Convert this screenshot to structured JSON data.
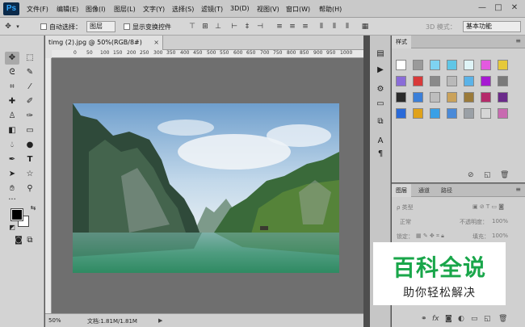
{
  "app": {
    "logo": "Ps"
  },
  "menu": {
    "items": [
      "文件(F)",
      "编辑(E)",
      "图像(I)",
      "图层(L)",
      "文字(Y)",
      "选择(S)",
      "滤镜(T)",
      "3D(D)",
      "视图(V)",
      "窗口(W)",
      "帮助(H)"
    ]
  },
  "window_controls": {
    "minimize": "—",
    "maximize": "□",
    "close": "✕"
  },
  "options_bar": {
    "auto_select_label": "自动选择：",
    "auto_select_value": "图层",
    "show_transform_label": "显示变换控件",
    "mode_3d_label": "3D 模式：",
    "workspace_value": "基本功能"
  },
  "document": {
    "tab_title": "timg (2).jpg @ 50%(RGB/8#)",
    "close": "×",
    "ruler_ticks": [
      "0",
      "50",
      "100",
      "150",
      "200",
      "250",
      "300",
      "350",
      "400",
      "450",
      "500",
      "550",
      "600",
      "650",
      "700",
      "750",
      "800",
      "850",
      "900",
      "950",
      "1000"
    ],
    "zoom": "50%",
    "doc_info": "文档:1.81M/1.81M"
  },
  "styles_panel": {
    "tab": "样式",
    "menu": "≡",
    "swatch_colors": [
      "#ffffff",
      "#9a9a9a",
      "#7ed3f2",
      "#5fc6e6",
      "#dff4f7",
      "#e35ae0",
      "#e6c93a",
      "#8a6cd8",
      "#d83a3a",
      "#8a8a8a",
      "#b9b9b9",
      "#5bb3e8",
      "#a61ad2",
      "#7a7a7a",
      "#2a2a2a",
      "#3b7fd8",
      "#bdbdbd",
      "#caa25a",
      "#9a7a3a",
      "#b42a6a",
      "#6a2a8a",
      "#2a6ad8",
      "#e0a21a",
      "#3aa0e6",
      "#4a8ad8",
      "#9aa0a6",
      "#d6d6d6",
      "#c86ab0"
    ]
  },
  "layers_panel": {
    "tabs": [
      "图层",
      "通道",
      "路径"
    ],
    "menu": "≡",
    "filter_kind": "ρ 类型",
    "blend_mode": "正常",
    "opacity_label": "不透明度：",
    "opacity_value": "100%",
    "lock_label": "锁定：",
    "fill_label": "填充：",
    "fill_value": "100%"
  },
  "watermark": {
    "title": "百科全说",
    "subtitle": "助你轻松解决"
  }
}
